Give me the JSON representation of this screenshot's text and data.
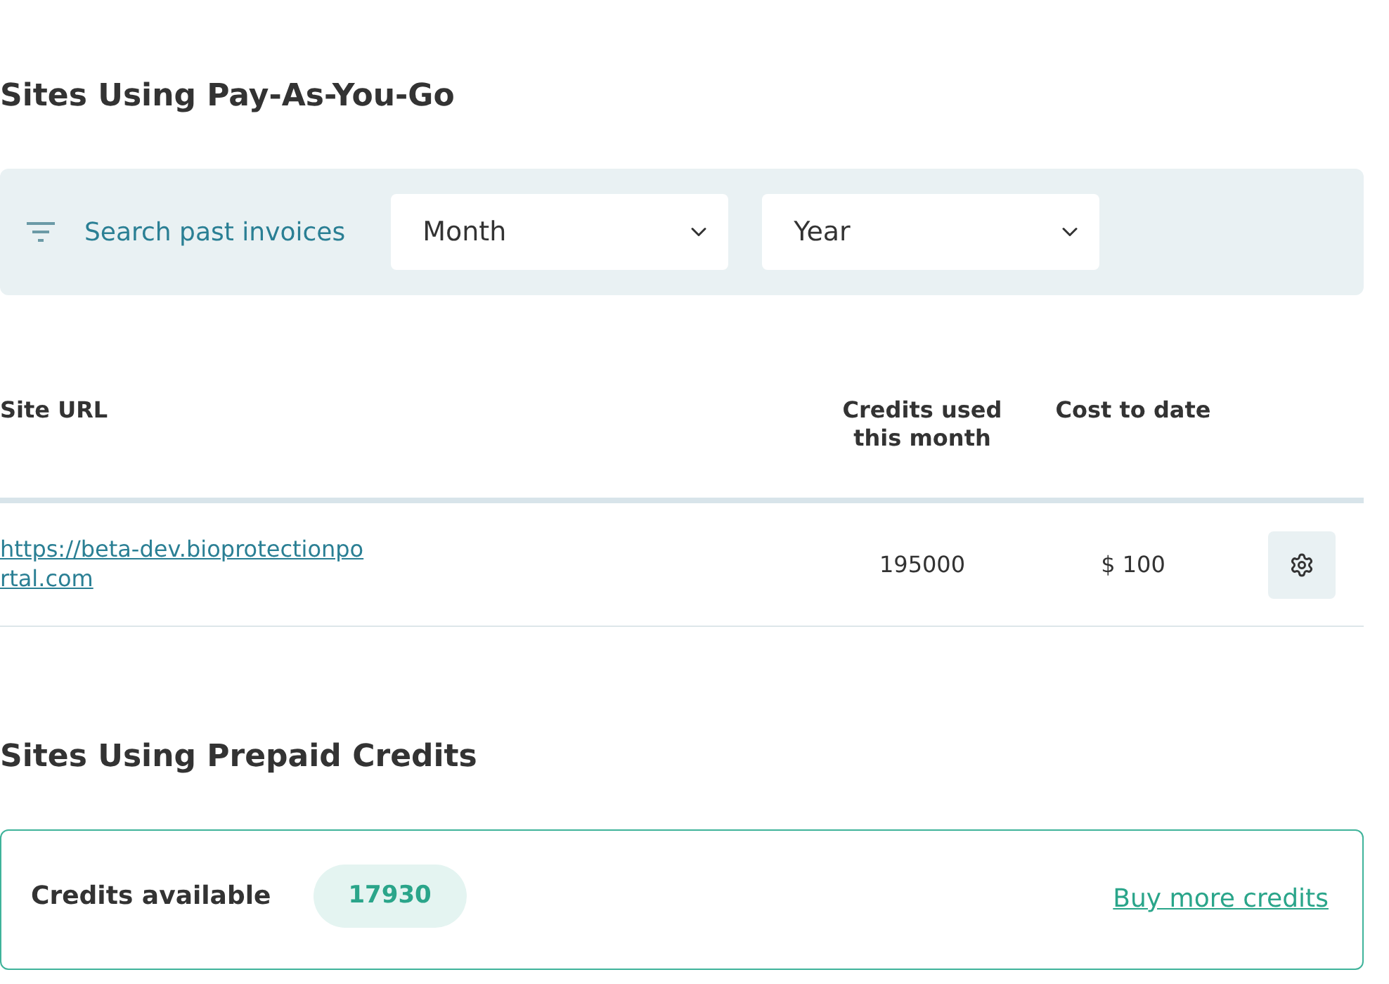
{
  "payg": {
    "title": "Sites Using Pay-As-You-Go",
    "filter": {
      "label": "Search past invoices",
      "selects": [
        {
          "value": "Month"
        },
        {
          "value": "Year"
        }
      ]
    },
    "table": {
      "columns": [
        "Site URL",
        "Credits used this month",
        "Cost to date"
      ],
      "rows": [
        {
          "url": "https://beta-dev.bioprotectionportal.com",
          "credits": "195000",
          "cost": "$ 100"
        }
      ]
    }
  },
  "prepaid": {
    "title": "Sites Using Prepaid Credits",
    "credits_label": "Credits available",
    "credits_value": "17930",
    "buy_link": "Buy more credits"
  }
}
